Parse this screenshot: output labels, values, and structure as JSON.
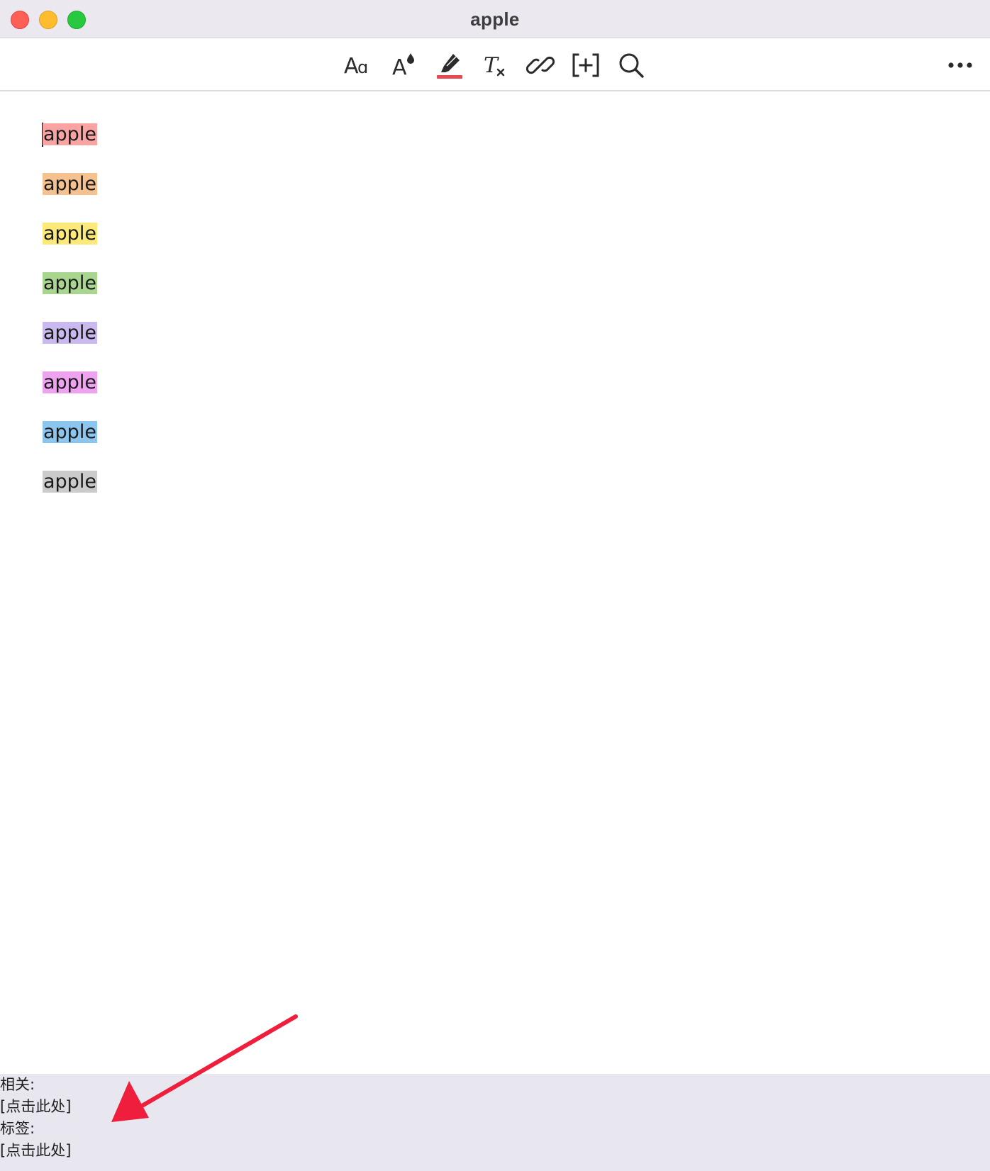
{
  "window": {
    "title": "apple"
  },
  "toolbar": {
    "tools": [
      {
        "name": "font-icon",
        "glyph": "Aα"
      },
      {
        "name": "text-color-icon"
      },
      {
        "name": "highlighter-icon",
        "accent": "#e8484f"
      },
      {
        "name": "clear-format-icon"
      },
      {
        "name": "link-icon"
      },
      {
        "name": "insert-bracket-icon"
      },
      {
        "name": "search-icon"
      },
      {
        "name": "more-icon"
      }
    ]
  },
  "editor": {
    "lines": [
      {
        "text": "apple",
        "highlight": "#f9a3a3"
      },
      {
        "text": "apple",
        "highlight": "#f5c18f"
      },
      {
        "text": "apple",
        "highlight": "#fbe97a"
      },
      {
        "text": "apple",
        "highlight": "#a8d68e"
      },
      {
        "text": "apple",
        "highlight": "#c9b9ef"
      },
      {
        "text": "apple",
        "highlight": "#eea2ef"
      },
      {
        "text": "apple",
        "highlight": "#8cc5ee"
      },
      {
        "text": "apple",
        "highlight": "#cbcbcb"
      }
    ]
  },
  "footer": {
    "related_label": "相关:",
    "related_link": "[点击此处]",
    "tags_label": "标签:",
    "tags_link": "[点击此处]"
  },
  "annotation": {
    "arrow_color": "#ee1e3c"
  }
}
